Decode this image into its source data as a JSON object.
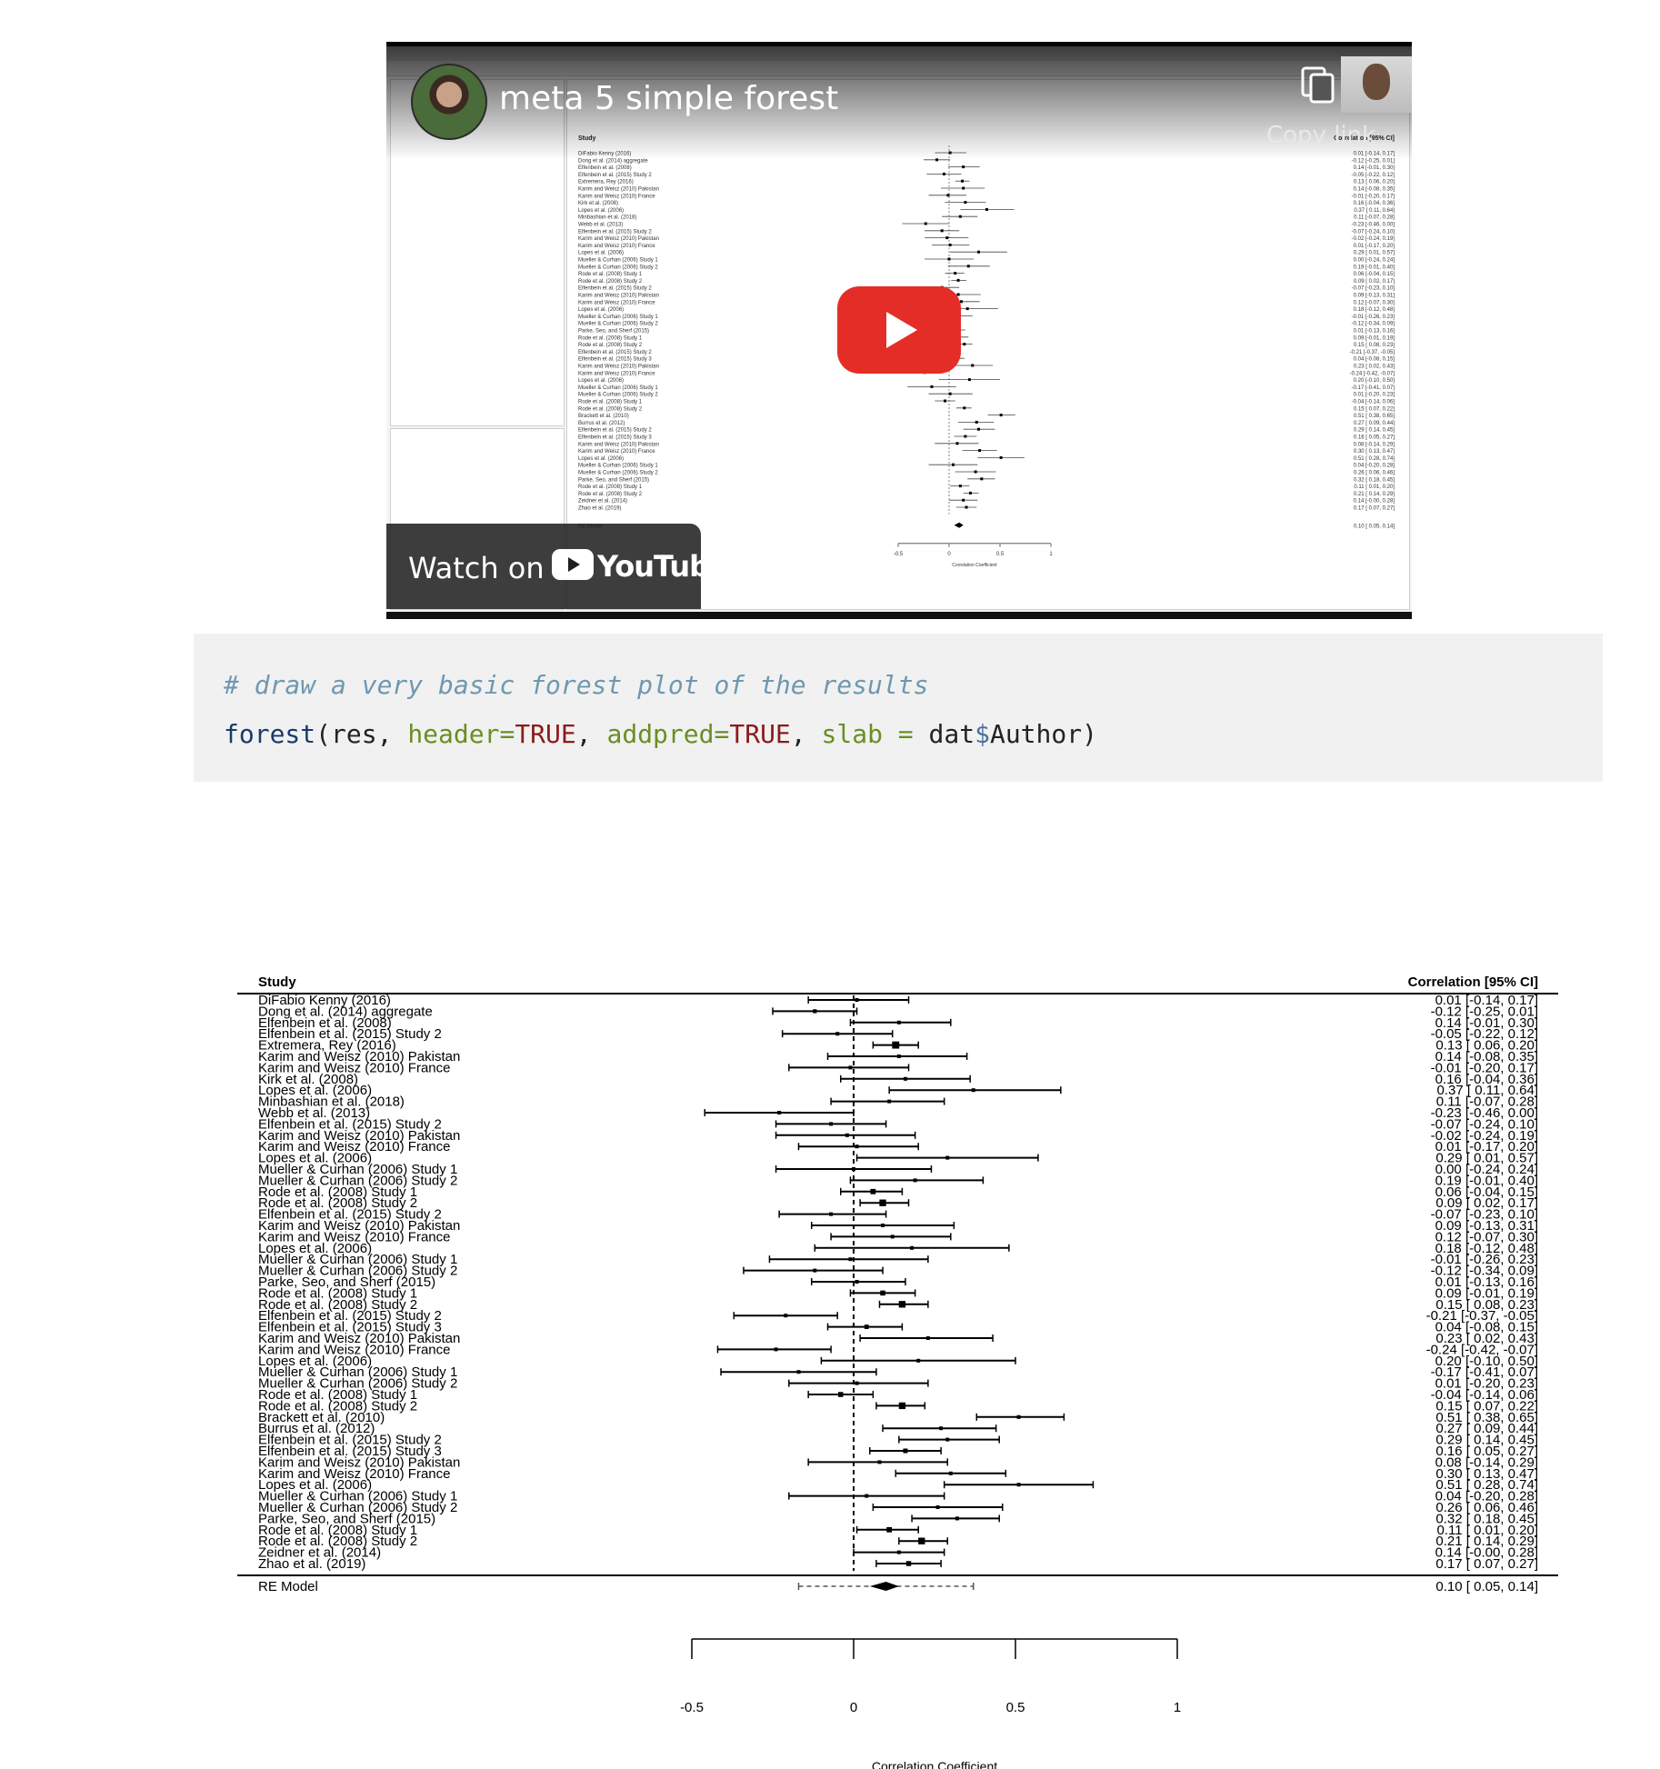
{
  "video": {
    "title": "meta 5 simple forest",
    "copy_link_label": "Copy link",
    "watch_on_label": "Watch on",
    "youtube_label": "YouTube"
  },
  "code": {
    "comment": "# draw a very basic forest plot of the results",
    "call": {
      "fn": "forest",
      "open": "(res, ",
      "arg1": "header",
      "eq1": "=",
      "val1": "TRUE",
      "sep1": ", ",
      "arg2": "addpred",
      "eq2": "=",
      "val2": "TRUE",
      "sep2": ", ",
      "arg3": "slab",
      "eq3": " = ",
      "obj": "dat",
      "dollar": "$",
      "field": "Author",
      "close": ")"
    }
  },
  "chart_data": {
    "type": "forest",
    "header_left": "Study",
    "header_right": "Correlation [95% CI]",
    "xlabel": "Correlation Coefficient",
    "xlim": [
      -0.5,
      1
    ],
    "xticks": [
      "-0.5",
      "0",
      "0.5",
      "1"
    ],
    "reference_line": 0,
    "studies": [
      {
        "label": "DiFabio Kenny (2016)",
        "est": 0.01,
        "lo": -0.14,
        "hi": 0.17,
        "ci": "0.01 [-0.14,  0.17]"
      },
      {
        "label": "Dong et al. (2014) aggregate",
        "est": -0.12,
        "lo": -0.25,
        "hi": 0.01,
        "ci": "-0.12 [-0.25,  0.01]"
      },
      {
        "label": "Elfenbein et al. (2008)",
        "est": 0.14,
        "lo": -0.01,
        "hi": 0.3,
        "ci": "0.14 [-0.01,  0.30]"
      },
      {
        "label": "Elfenbein et al. (2015) Study 2",
        "est": -0.05,
        "lo": -0.22,
        "hi": 0.12,
        "ci": "-0.05 [-0.22,  0.12]"
      },
      {
        "label": "Extremera, Rey (2016)",
        "est": 0.13,
        "lo": 0.06,
        "hi": 0.2,
        "ci": "0.13 [ 0.06,  0.20]"
      },
      {
        "label": "Karim and Weisz  (2010) Pakistan",
        "est": 0.14,
        "lo": -0.08,
        "hi": 0.35,
        "ci": "0.14 [-0.08,  0.35]"
      },
      {
        "label": "Karim and Weisz (2010) France",
        "est": -0.01,
        "lo": -0.2,
        "hi": 0.17,
        "ci": "-0.01 [-0.20,  0.17]"
      },
      {
        "label": "Kirk et al. (2008)",
        "est": 0.16,
        "lo": -0.04,
        "hi": 0.36,
        "ci": "0.16 [-0.04,  0.36]"
      },
      {
        "label": "Lopes et al. (2006)",
        "est": 0.37,
        "lo": 0.11,
        "hi": 0.64,
        "ci": "0.37 [ 0.11,  0.64]"
      },
      {
        "label": "Minbashian et al. (2018)",
        "est": 0.11,
        "lo": -0.07,
        "hi": 0.28,
        "ci": "0.11 [-0.07,  0.28]"
      },
      {
        "label": "Webb et al. (2013)",
        "est": -0.23,
        "lo": -0.46,
        "hi": 0.0,
        "ci": "-0.23 [-0.46,  0.00]"
      },
      {
        "label": "Elfenbein et al. (2015) Study 2",
        "est": -0.07,
        "lo": -0.24,
        "hi": 0.1,
        "ci": "-0.07 [-0.24,  0.10]"
      },
      {
        "label": "Karim and Weisz  (2010) Pakistan",
        "est": -0.02,
        "lo": -0.24,
        "hi": 0.19,
        "ci": "-0.02 [-0.24,  0.19]"
      },
      {
        "label": "Karim and Weisz (2010) France",
        "est": 0.01,
        "lo": -0.17,
        "hi": 0.2,
        "ci": "0.01 [-0.17,  0.20]"
      },
      {
        "label": "Lopes et al. (2006)",
        "est": 0.29,
        "lo": 0.01,
        "hi": 0.57,
        "ci": "0.29 [ 0.01,  0.57]"
      },
      {
        "label": "Mueller & Curhan (2006) Study 1",
        "est": 0.0,
        "lo": -0.24,
        "hi": 0.24,
        "ci": "0.00 [-0.24,  0.24]"
      },
      {
        "label": "Mueller & Curhan (2006) Study 2",
        "est": 0.19,
        "lo": -0.01,
        "hi": 0.4,
        "ci": "0.19 [-0.01,  0.40]"
      },
      {
        "label": "Rode et al. (2008) Study 1",
        "est": 0.06,
        "lo": -0.04,
        "hi": 0.15,
        "ci": "0.06 [-0.04,  0.15]"
      },
      {
        "label": "Rode et al. (2008) Study 2",
        "est": 0.09,
        "lo": 0.02,
        "hi": 0.17,
        "ci": "0.09 [ 0.02,  0.17]"
      },
      {
        "label": "Elfenbein et al. (2015) Study 2",
        "est": -0.07,
        "lo": -0.23,
        "hi": 0.1,
        "ci": "-0.07 [-0.23,  0.10]"
      },
      {
        "label": "Karim and Weisz  (2010) Pakistan",
        "est": 0.09,
        "lo": -0.13,
        "hi": 0.31,
        "ci": "0.09 [-0.13,  0.31]"
      },
      {
        "label": "Karim and Weisz (2010) France",
        "est": 0.12,
        "lo": -0.07,
        "hi": 0.3,
        "ci": "0.12 [-0.07,  0.30]"
      },
      {
        "label": "Lopes et al. (2006)",
        "est": 0.18,
        "lo": -0.12,
        "hi": 0.48,
        "ci": "0.18 [-0.12,  0.48]"
      },
      {
        "label": "Mueller & Curhan (2006) Study 1",
        "est": -0.01,
        "lo": -0.26,
        "hi": 0.23,
        "ci": "-0.01 [-0.26,  0.23]"
      },
      {
        "label": "Mueller & Curhan (2006) Study 2",
        "est": -0.12,
        "lo": -0.34,
        "hi": 0.09,
        "ci": "-0.12 [-0.34,  0.09]"
      },
      {
        "label": "Parke, Seo, and Sherf (2015)",
        "est": 0.01,
        "lo": -0.13,
        "hi": 0.16,
        "ci": "0.01 [-0.13,  0.16]"
      },
      {
        "label": "Rode et al. (2008) Study 1",
        "est": 0.09,
        "lo": -0.01,
        "hi": 0.19,
        "ci": "0.09 [-0.01,  0.19]"
      },
      {
        "label": "Rode et al. (2008) Study 2",
        "est": 0.15,
        "lo": 0.08,
        "hi": 0.23,
        "ci": "0.15 [ 0.08,  0.23]"
      },
      {
        "label": "Elfenbein et al. (2015) Study 2",
        "est": -0.21,
        "lo": -0.37,
        "hi": -0.05,
        "ci": "-0.21 [-0.37, -0.05]"
      },
      {
        "label": "Elfenbein et al. (2015) Study 3",
        "est": 0.04,
        "lo": -0.08,
        "hi": 0.15,
        "ci": "0.04 [-0.08,  0.15]"
      },
      {
        "label": "Karim and Weisz  (2010) Pakistan",
        "est": 0.23,
        "lo": 0.02,
        "hi": 0.43,
        "ci": "0.23 [ 0.02,  0.43]"
      },
      {
        "label": "Karim and Weisz (2010) France",
        "est": -0.24,
        "lo": -0.42,
        "hi": -0.07,
        "ci": "-0.24 [-0.42, -0.07]"
      },
      {
        "label": "Lopes et al. (2006)",
        "est": 0.2,
        "lo": -0.1,
        "hi": 0.5,
        "ci": "0.20 [-0.10,  0.50]"
      },
      {
        "label": "Mueller & Curhan (2006) Study 1",
        "est": -0.17,
        "lo": -0.41,
        "hi": 0.07,
        "ci": "-0.17 [-0.41,  0.07]"
      },
      {
        "label": "Mueller & Curhan (2006) Study 2",
        "est": 0.01,
        "lo": -0.2,
        "hi": 0.23,
        "ci": "0.01 [-0.20,  0.23]"
      },
      {
        "label": "Rode et al. (2008) Study 1",
        "est": -0.04,
        "lo": -0.14,
        "hi": 0.06,
        "ci": "-0.04 [-0.14,  0.06]"
      },
      {
        "label": "Rode et al. (2008) Study 2",
        "est": 0.15,
        "lo": 0.07,
        "hi": 0.22,
        "ci": "0.15 [ 0.07,  0.22]"
      },
      {
        "label": "Brackett et al. (2010)",
        "est": 0.51,
        "lo": 0.38,
        "hi": 0.65,
        "ci": "0.51 [ 0.38,  0.65]"
      },
      {
        "label": "Burrus et al. (2012)",
        "est": 0.27,
        "lo": 0.09,
        "hi": 0.44,
        "ci": "0.27 [ 0.09,  0.44]"
      },
      {
        "label": "Elfenbein et al. (2015) Study 2",
        "est": 0.29,
        "lo": 0.14,
        "hi": 0.45,
        "ci": "0.29 [ 0.14,  0.45]"
      },
      {
        "label": "Elfenbein et al. (2015) Study 3",
        "est": 0.16,
        "lo": 0.05,
        "hi": 0.27,
        "ci": "0.16 [ 0.05,  0.27]"
      },
      {
        "label": "Karim and Weisz  (2010) Pakistan",
        "est": 0.08,
        "lo": -0.14,
        "hi": 0.29,
        "ci": "0.08 [-0.14,  0.29]"
      },
      {
        "label": "Karim and Weisz (2010) France",
        "est": 0.3,
        "lo": 0.13,
        "hi": 0.47,
        "ci": "0.30 [ 0.13,  0.47]"
      },
      {
        "label": "Lopes et al. (2006)",
        "est": 0.51,
        "lo": 0.28,
        "hi": 0.74,
        "ci": "0.51 [ 0.28,  0.74]"
      },
      {
        "label": "Mueller & Curhan (2006) Study 1",
        "est": 0.04,
        "lo": -0.2,
        "hi": 0.28,
        "ci": "0.04 [-0.20,  0.28]"
      },
      {
        "label": "Mueller & Curhan (2006) Study 2",
        "est": 0.26,
        "lo": 0.06,
        "hi": 0.46,
        "ci": "0.26 [ 0.06,  0.46]"
      },
      {
        "label": "Parke, Seo, and Sherf (2015)",
        "est": 0.32,
        "lo": 0.18,
        "hi": 0.45,
        "ci": "0.32 [ 0.18,  0.45]"
      },
      {
        "label": "Rode et al. (2008) Study 1",
        "est": 0.11,
        "lo": 0.01,
        "hi": 0.2,
        "ci": "0.11 [ 0.01,  0.20]"
      },
      {
        "label": "Rode et al. (2008) Study 2",
        "est": 0.21,
        "lo": 0.14,
        "hi": 0.29,
        "ci": "0.21 [ 0.14,  0.29]"
      },
      {
        "label": "Zeidner et al. (2014)",
        "est": 0.14,
        "lo": 0.0,
        "hi": 0.28,
        "ci": "0.14 [-0.00,  0.28]"
      },
      {
        "label": "Zhao et al. (2019)",
        "est": 0.17,
        "lo": 0.07,
        "hi": 0.27,
        "ci": "0.17 [ 0.07,  0.27]"
      }
    ],
    "summary": {
      "label": "RE Model",
      "est": 0.1,
      "lo": 0.05,
      "hi": 0.14,
      "pi_lo": -0.17,
      "pi_hi": 0.37,
      "ci": "0.10 [ 0.05,  0.14]"
    }
  }
}
